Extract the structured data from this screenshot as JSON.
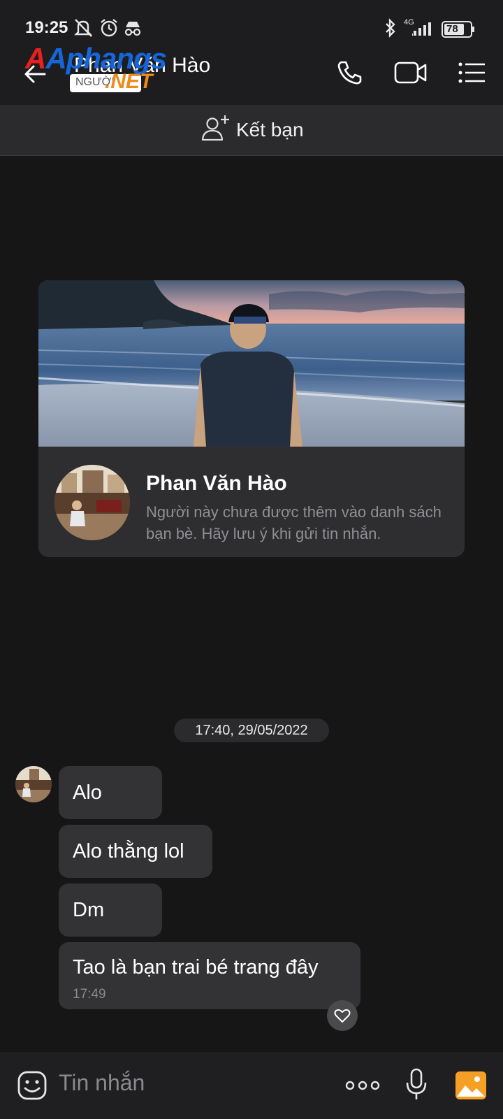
{
  "status_bar": {
    "time": "19:25",
    "network": "4G",
    "battery": "78"
  },
  "header": {
    "title": "Phan Văn Hào",
    "watermark": {
      "logo_main": "Aphangs",
      "logo_sub": "NGƯỜI",
      "logo_net": ".NET"
    }
  },
  "add_friend": {
    "label": "Kết bạn"
  },
  "profile_card": {
    "name": "Phan Văn Hào",
    "note": "Người này chưa được thêm vào danh sách bạn bè. Hãy lưu ý khi gửi tin nhắn."
  },
  "chat": {
    "date_stamp": "17:40, 29/05/2022",
    "messages": [
      {
        "text": "Alo"
      },
      {
        "text": "Alo thằng lol"
      },
      {
        "text": "Dm"
      },
      {
        "text": "Tao là bạn trai bé trang đây",
        "time": "17:49"
      }
    ]
  },
  "composer": {
    "placeholder": "Tin nhắn"
  },
  "colors": {
    "background": "#161616",
    "bubble": "#333335",
    "card": "#2e2e30",
    "muted_text": "#8f8f94",
    "gallery_icon": "#f5a024"
  },
  "icons": [
    "back-arrow-icon",
    "phone-icon",
    "video-call-icon",
    "menu-list-icon",
    "add-friend-icon",
    "heart-icon",
    "emoji-icon",
    "more-icon",
    "microphone-icon",
    "gallery-icon",
    "bluetooth-icon",
    "signal-icon",
    "battery-icon",
    "mute-icon",
    "alarm-icon",
    "incognito-icon"
  ]
}
